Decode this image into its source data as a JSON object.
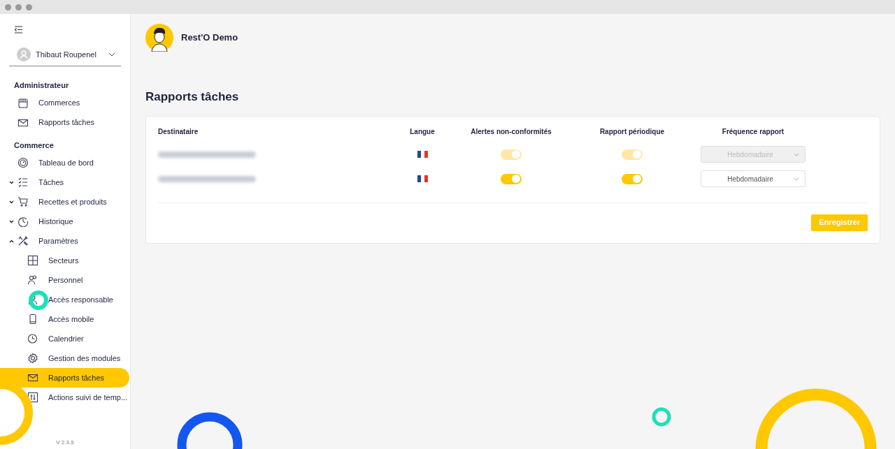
{
  "user": {
    "name": "Thibaut Roupenel"
  },
  "sidebar": {
    "sections": [
      {
        "title": "Administrateur",
        "items": [
          {
            "label": "Commerces",
            "selected": false
          },
          {
            "label": "Rapports tâches",
            "selected": false
          }
        ]
      },
      {
        "title": "Commerce",
        "items": [
          {
            "label": "Tableau de bord",
            "selected": false
          },
          {
            "label": "Tâches",
            "selected": false,
            "expanded": false
          },
          {
            "label": "Recettes et produits",
            "selected": false,
            "expanded": false
          },
          {
            "label": "Historique",
            "selected": false,
            "expanded": false
          },
          {
            "label": "Paramètres",
            "selected": false,
            "expanded": true,
            "children": [
              {
                "label": "Secteurs",
                "selected": false
              },
              {
                "label": "Personnel",
                "selected": false
              },
              {
                "label": "Accès responsable",
                "selected": false
              },
              {
                "label": "Accès mobile",
                "selected": false
              },
              {
                "label": "Calendrier",
                "selected": false
              },
              {
                "label": "Gestion des modules",
                "selected": false
              },
              {
                "label": "Rapports tâches",
                "selected": true
              },
              {
                "label": "Actions suivi de temp..."
              }
            ]
          }
        ]
      }
    ]
  },
  "version": "V 2.3.5",
  "header": {
    "title": "Rest'O Demo"
  },
  "page_title": "Rapports tâches",
  "table": {
    "columns": [
      "Destinataire",
      "Langue",
      "Alertes non-conformités",
      "Rapport périodique",
      "Fréquence rapport"
    ],
    "rows": [
      {
        "disabled": true,
        "alerts_on": true,
        "report_on": true,
        "frequency": "Hebdomadaire"
      },
      {
        "disabled": false,
        "alerts_on": true,
        "report_on": true,
        "frequency": "Hebdomadaire"
      }
    ]
  },
  "save_button": "Enregistrer"
}
